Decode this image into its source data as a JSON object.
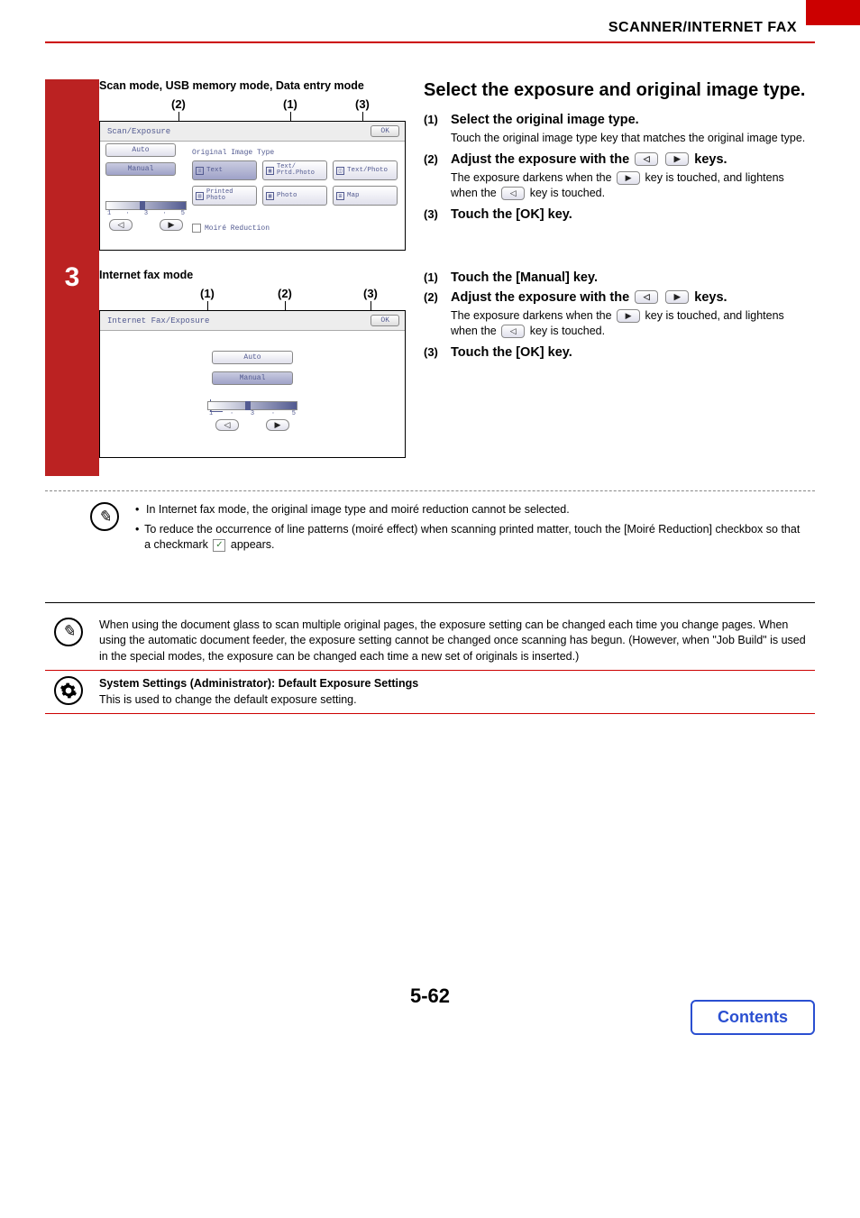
{
  "header": {
    "breadcrumb": "SCANNER/INTERNET FAX"
  },
  "step_number": "3",
  "scan_mode": {
    "title": "Scan mode, USB memory mode, Data entry mode",
    "callouts": {
      "c1": "(1)",
      "c2": "(2)",
      "c3": "(3)"
    },
    "panel_title": "Scan/Exposure",
    "ok": "OK",
    "auto": "Auto",
    "manual": "Manual",
    "orig_label": "Original Image Type",
    "types": {
      "text": "Text",
      "text_prtd": "Text/\nPrtd.Photo",
      "text_photo": "Text/Photo",
      "printed_photo": "Printed\nPhoto",
      "photo": "Photo",
      "map": "Map"
    },
    "scale": {
      "min": "1",
      "max": "5",
      "dot": "·"
    },
    "moire": "Moiré Reduction"
  },
  "ifax_mode": {
    "title": "Internet fax mode",
    "callouts": {
      "c1": "(1)",
      "c2": "(2)",
      "c3": "(3)"
    },
    "panel_title": "Internet Fax/Exposure",
    "ok": "OK",
    "auto": "Auto",
    "manual": "Manual",
    "scale": {
      "min": "1",
      "max": "5",
      "dot": "·"
    }
  },
  "right": {
    "title": "Select the exposure and original image type.",
    "s1": {
      "num": "(1)",
      "heading": "Select the original image type.",
      "desc": "Touch the original image type key that matches the original image type."
    },
    "s2": {
      "num": "(2)",
      "heading_a": "Adjust the exposure with the ",
      "heading_b": " keys.",
      "desc_a": "The exposure darkens when the ",
      "desc_b": " key is touched, and lightens when the ",
      "desc_c": " key is touched."
    },
    "s3": {
      "num": "(3)",
      "heading": "Touch the [OK] key."
    }
  },
  "right2": {
    "s1": {
      "num": "(1)",
      "heading": "Touch the [Manual] key."
    },
    "s2": {
      "num": "(2)",
      "heading_a": "Adjust the exposure with the ",
      "heading_b": " keys.",
      "desc_a": "The exposure darkens when the ",
      "desc_b": " key is touched, and lightens when the ",
      "desc_c": " key is touched."
    },
    "s3": {
      "num": "(3)",
      "heading": "Touch the [OK] key."
    }
  },
  "notes": {
    "b1": "In Internet fax mode, the original image type and moiré reduction cannot be selected.",
    "b2_a": "To reduce the occurrence of line patterns (moiré effect) when scanning printed matter, touch the [Moiré Reduction] checkbox so that a checkmark ",
    "b2_b": " appears."
  },
  "info1": "When using the document glass to scan multiple original pages, the exposure setting can be changed each time you change pages. When using the automatic document feeder, the exposure setting cannot be changed once scanning has begun. (However, when \"Job Build\" is used in the special modes, the exposure can be changed each time a new set of originals is inserted.)",
  "info2": {
    "heading": "System Settings (Administrator): Default Exposure Settings",
    "desc": "This is used to change the default exposure setting."
  },
  "footer": {
    "page": "5-62",
    "contents": "Contents"
  }
}
